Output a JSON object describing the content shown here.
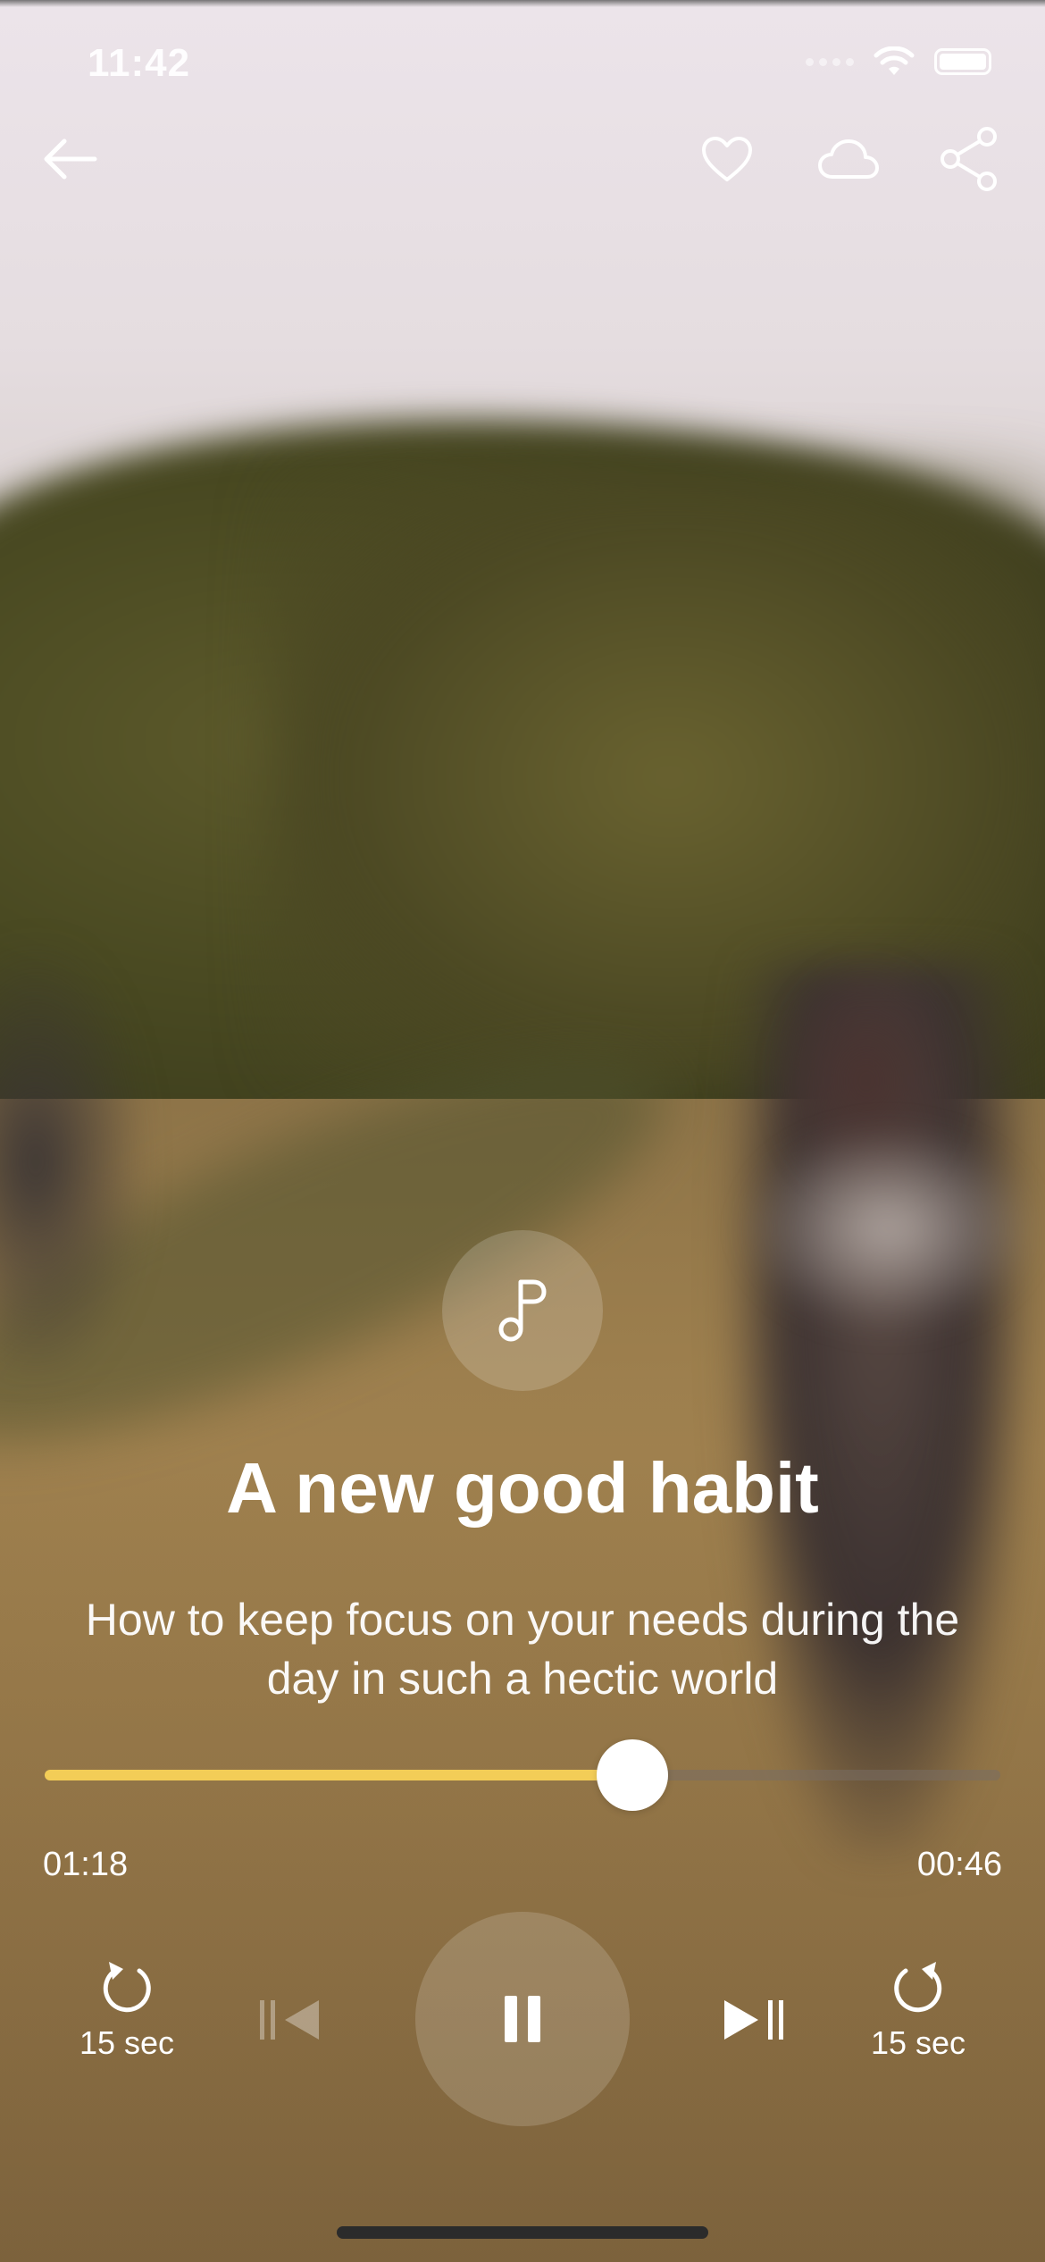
{
  "status_bar": {
    "time": "11:42"
  },
  "nav": {
    "back_icon": "arrow-left-icon",
    "favorite_icon": "heart-icon",
    "download_icon": "cloud-icon",
    "share_icon": "share-icon"
  },
  "track": {
    "icon": "music-note-icon",
    "title": "A new good habit",
    "description": "How to keep focus on your needs during the day in such a hectic world"
  },
  "player": {
    "progress": 0.615,
    "elapsed": "01:18",
    "remaining": "00:46",
    "rewind_label": "15 sec",
    "forward_label": "15 sec",
    "state": "playing"
  },
  "colors": {
    "progress_fill": "#f3cd57",
    "progress_track": "#786e64",
    "text": "#ffffff"
  }
}
